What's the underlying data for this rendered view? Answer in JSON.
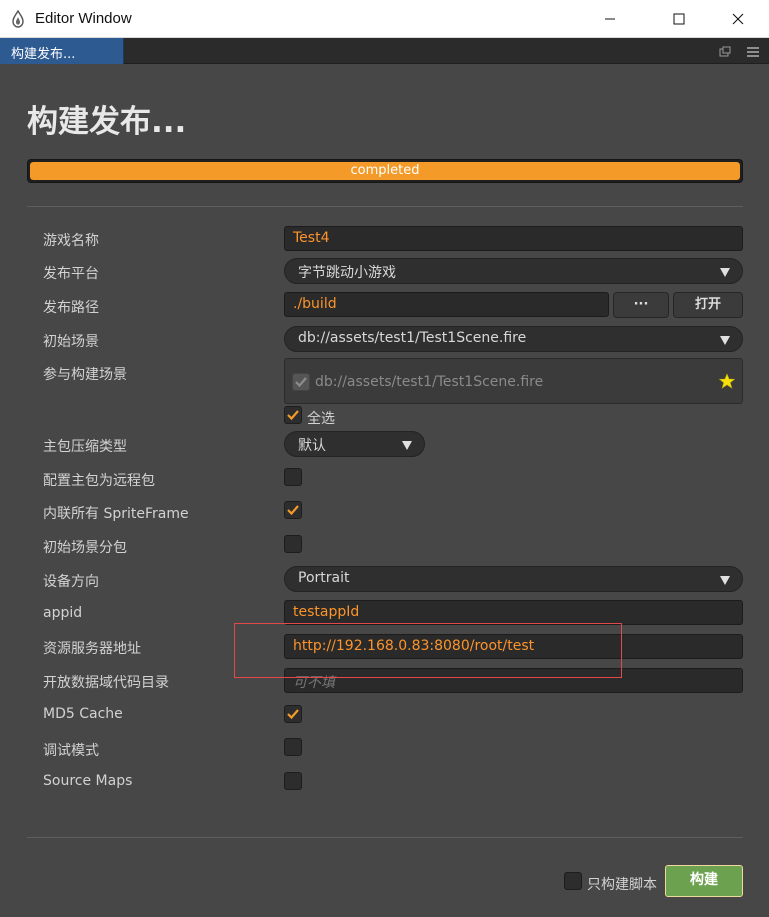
{
  "window": {
    "title": "Editor Window",
    "tab": "构建发布..."
  },
  "page": {
    "title": "构建发布...",
    "progress": {
      "label": "completed",
      "percent": 100,
      "color": "#f39a28"
    }
  },
  "form": {
    "game_name": {
      "label": "游戏名称",
      "value": "Test4"
    },
    "platform": {
      "label": "发布平台",
      "value": "字节跳动小游戏"
    },
    "build_path": {
      "label": "发布路径",
      "value": "./build",
      "browse": "···",
      "open": "打开"
    },
    "start_scene": {
      "label": "初始场景",
      "value": "db://assets/test1/Test1Scene.fire"
    },
    "scenes": {
      "label": "参与构建场景",
      "items": [
        "db://assets/test1/Test1Scene.fire"
      ],
      "select_all": "全选",
      "select_all_checked": true
    },
    "compression": {
      "label": "主包压缩类型",
      "value": "默认"
    },
    "remote_main": {
      "label": "配置主包为远程包",
      "checked": false
    },
    "inline_sprite": {
      "label": "内联所有 SpriteFrame",
      "checked": true
    },
    "start_scene_subpack": {
      "label": "初始场景分包",
      "checked": false
    },
    "orientation": {
      "label": "设备方向",
      "value": "Portrait"
    },
    "appid": {
      "label": "appid",
      "value": "testappId"
    },
    "resource_server": {
      "label": "资源服务器地址",
      "value": "http://192.168.0.83:8080/root/test"
    },
    "open_data_dir": {
      "label": "开放数据域代码目录",
      "placeholder": "可不填"
    },
    "md5_cache": {
      "label": "MD5 Cache",
      "checked": true
    },
    "debug": {
      "label": "调试模式",
      "checked": false
    },
    "source_maps": {
      "label": "Source Maps",
      "checked": false
    }
  },
  "footer": {
    "build_script_only": {
      "label": "只构建脚本",
      "checked": false
    },
    "build_button": "构建"
  },
  "colors": {
    "accent": "#fd942b",
    "tab_active": "#2e5a92",
    "build_button": "#6ca24f",
    "annotation": "#e2494b"
  }
}
